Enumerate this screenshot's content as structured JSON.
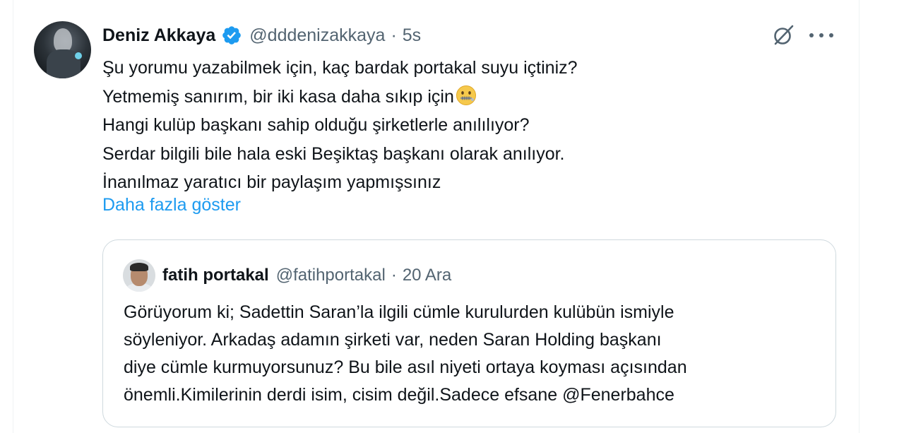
{
  "tweet": {
    "author_name": "Deniz Akkaya",
    "handle": "@dddenizakkaya",
    "separator": "·",
    "time": "5s",
    "lines": [
      "Şu yorumu yazabilmek için, kaç bardak portakal suyu içtiniz?",
      "Yetmemiş  sanırım, bir iki kasa daha sıkıp için",
      "Hangi kulüp başkanı sahip olduğu şirketlerle  anılılıyor?",
      "Serdar bilgili bile hala eski Beşiktaş başkanı olarak anılıyor.",
      "İnanılmaz yaratıcı bir paylaşım yapmışsınız"
    ],
    "emoji_icon": "zipper-mouth-face-icon",
    "show_more": "Daha fazla göster"
  },
  "quote": {
    "author_name": "fatih portakal",
    "handle": "@fatihportakal",
    "separator": "·",
    "time": "20 Ara",
    "lines": [
      "Görüyorum ki; Sadettin Saran’la ilgili cümle kurulurden kulübün ismiyle",
      "söyleniyor. Arkadaş adamın şirketi var, neden Saran Holding başkanı",
      "diye cümle kurmuyorsunuz? Bu bile asıl niyeti ortaya koyması açısından",
      "önemli.Kimilerinin derdi isim, cisim değil.Sadece efsane @Fenerbahce"
    ]
  },
  "icons": {
    "verified": "verified-badge-icon",
    "grok": "grok-icon",
    "more": "more-options-icon"
  },
  "colors": {
    "text": "#0f1419",
    "secondary": "#536471",
    "link": "#1d9bf0",
    "verified": "#1d9bf0",
    "border": "#cfd9de"
  }
}
